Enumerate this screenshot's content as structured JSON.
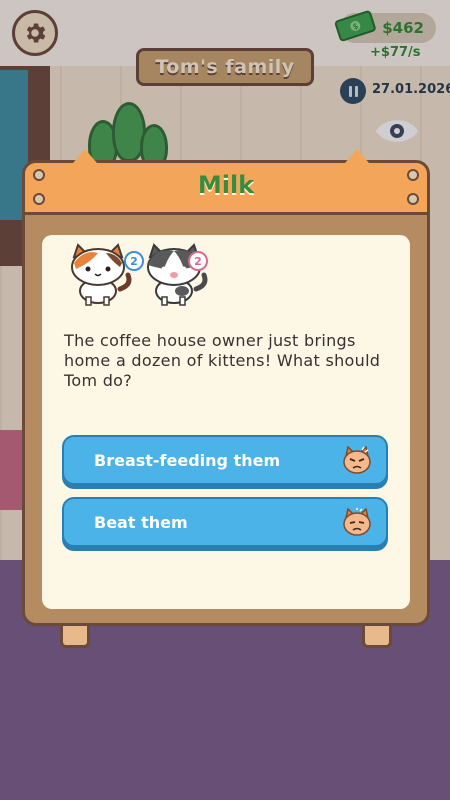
{
  "hud": {
    "family_name": "Tom's family",
    "money": "$462",
    "income": "+$77/s",
    "date": "27.01.2026"
  },
  "modal": {
    "title": "Milk",
    "cats": [
      {
        "name": "calico-cat",
        "count": "2",
        "badge_color": "#3a8fd6"
      },
      {
        "name": "gray-white-cat",
        "count": "2",
        "badge_color": "#d66a8f"
      }
    ],
    "question": "The coffee house owner just brings home a dozen of kittens! What should Tom do?",
    "options": [
      {
        "label": "Breast-feeding them",
        "icon": "angry-cat-face-icon"
      },
      {
        "label": "Beat them",
        "icon": "sad-cat-face-icon"
      }
    ]
  },
  "colors": {
    "title_green": "#3c8a3c",
    "option_blue": "#4bb3e8",
    "header_orange": "#f3a55a",
    "frame_brown": "#6b4a3a",
    "money_green": "#2f8a2f"
  }
}
